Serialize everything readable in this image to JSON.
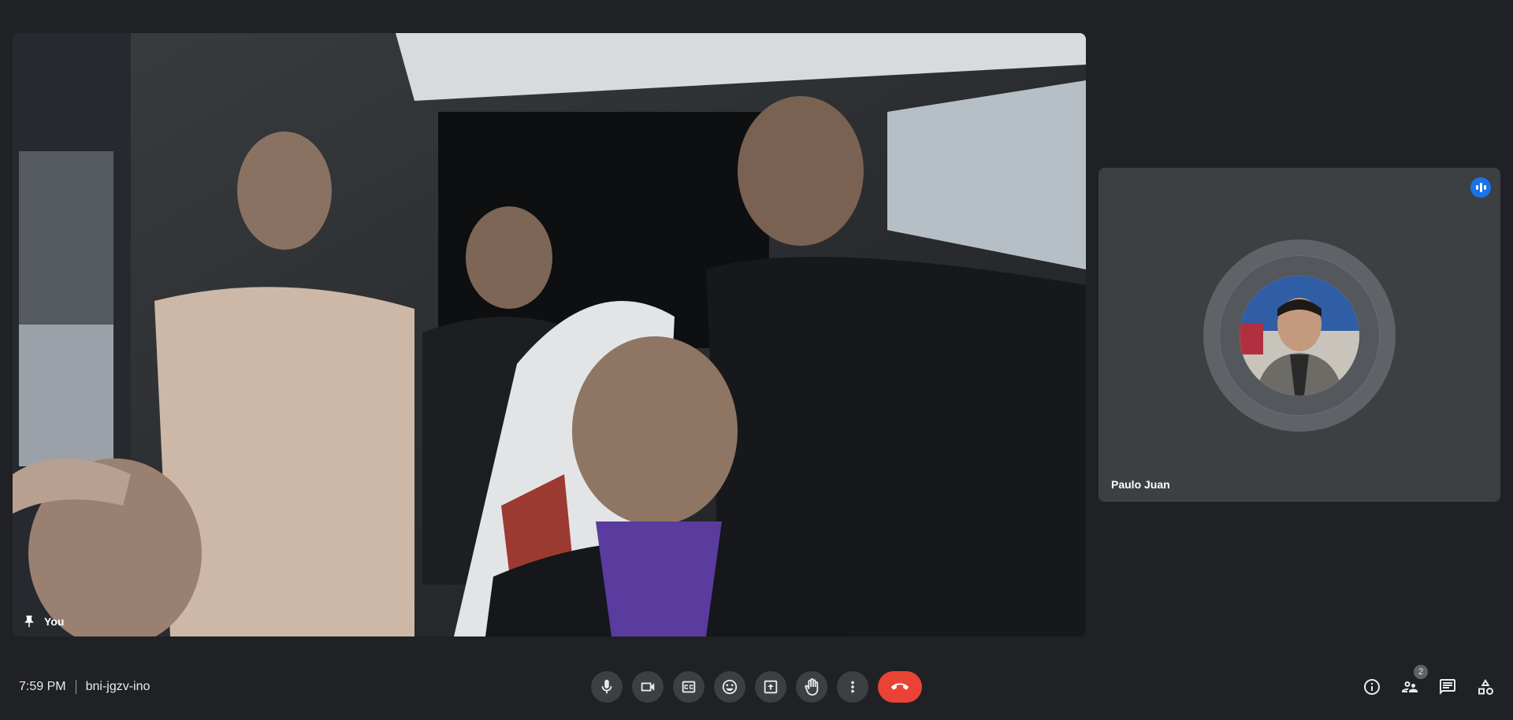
{
  "meeting": {
    "time": "7:59 PM",
    "code": "bni-jgzv-ino"
  },
  "main_tile": {
    "label": "You",
    "pin_icon": "pin-icon"
  },
  "side_tile": {
    "name": "Paulo Juan",
    "speaking_icon": "speaking-indicator-icon"
  },
  "controls": [
    {
      "name": "microphone",
      "icon": "mic-icon"
    },
    {
      "name": "camera",
      "icon": "camera-icon"
    },
    {
      "name": "captions",
      "icon": "captions-icon"
    },
    {
      "name": "reactions",
      "icon": "emoji-icon"
    },
    {
      "name": "present",
      "icon": "present-screen-icon"
    },
    {
      "name": "raise-hand",
      "icon": "hand-icon"
    },
    {
      "name": "more-options",
      "icon": "more-vert-icon"
    },
    {
      "name": "leave-call",
      "icon": "call-end-icon"
    }
  ],
  "right_panel": {
    "info_icon": "info-icon",
    "people_icon": "people-icon",
    "people_count": "2",
    "chat_icon": "chat-icon",
    "activities_icon": "activities-icon"
  },
  "colors": {
    "background": "#202124",
    "control_bg": "#3c4043",
    "end_call": "#ea4335",
    "speaking": "#1a73e8"
  }
}
